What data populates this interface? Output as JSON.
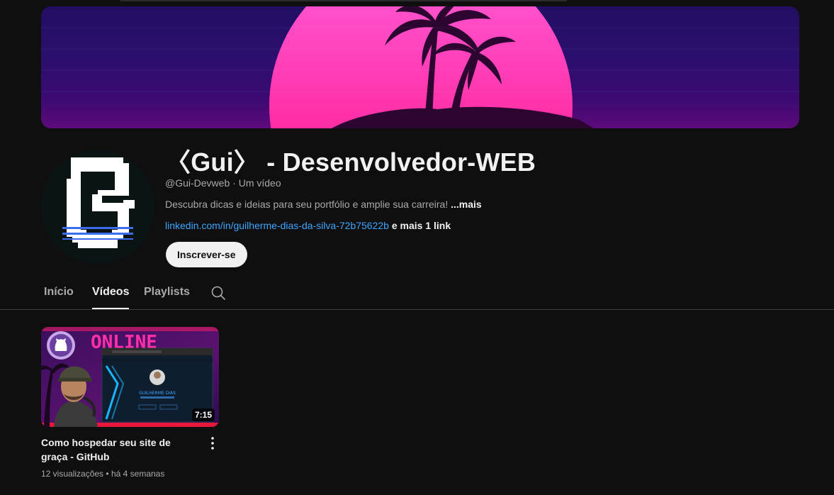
{
  "channel": {
    "title": "〈Gui〉 - Desenvolvedor-WEB",
    "handle": "@Gui-Devweb",
    "video_count": "Um vídeo",
    "separator": "·",
    "description": "Descubra dicas e ideias para seu portfólio e amplie sua carreira!",
    "description_more": "...mais",
    "link": "linkedin.com/in/guilherme-dias-da-silva-72b75622b",
    "more_links": "e mais 1 link",
    "subscribe_label": "Inscrever-se"
  },
  "tabs": [
    {
      "label": "Início",
      "active": false
    },
    {
      "label": "Vídeos",
      "active": true
    },
    {
      "label": "Playlists",
      "active": false
    }
  ],
  "videos": [
    {
      "title": "Como hospedar seu site de graça - GitHub",
      "duration": "7:15",
      "views": "12 visualizações",
      "separator": "•",
      "age": "há 4 semanas",
      "thumb_text": "ONLINE",
      "thumb_name": "GUILHERME DIAS"
    }
  ],
  "colors": {
    "background": "#0f0f0f",
    "link": "#3ea6ff",
    "text_primary": "#f1f1f1",
    "text_secondary": "#aaaaaa",
    "sun_top": "#ff4fd0",
    "sun_bottom": "#ff0a7a"
  },
  "icons": {
    "search": "search-icon",
    "more": "more-vert-icon"
  }
}
